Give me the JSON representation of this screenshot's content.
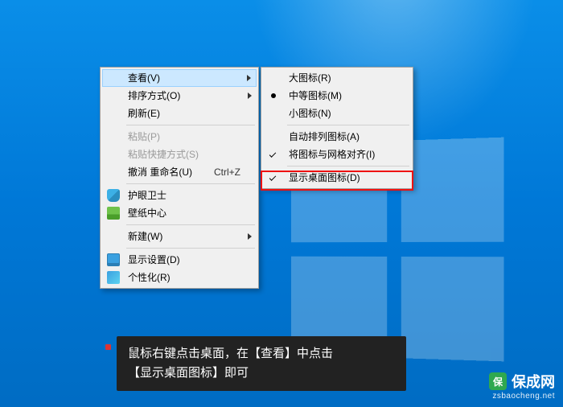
{
  "primary_menu": {
    "view": "查看(V)",
    "sort": "排序方式(O)",
    "refresh": "刷新(E)",
    "paste": "粘贴(P)",
    "paste_shortcut": "粘贴快捷方式(S)",
    "undo_rename": "撤消 重命名(U)",
    "undo_shortcut": "Ctrl+Z",
    "eyecare": "护眼卫士",
    "wallpaper": "壁纸中心",
    "new": "新建(W)",
    "display_settings": "显示设置(D)",
    "personalize": "个性化(R)"
  },
  "sub_menu": {
    "large_icons": "大图标(R)",
    "medium_icons": "中等图标(M)",
    "small_icons": "小图标(N)",
    "auto_arrange": "自动排列图标(A)",
    "align_grid": "将图标与网格对齐(I)",
    "show_desktop_icons": "显示桌面图标(D)"
  },
  "caption": {
    "line1": "鼠标右键点击桌面，在【查看】中点击",
    "line2": "【显示桌面图标】即可"
  },
  "watermark": {
    "logo_char": "保",
    "name": "保成网",
    "url": "zsbaocheng.net"
  }
}
